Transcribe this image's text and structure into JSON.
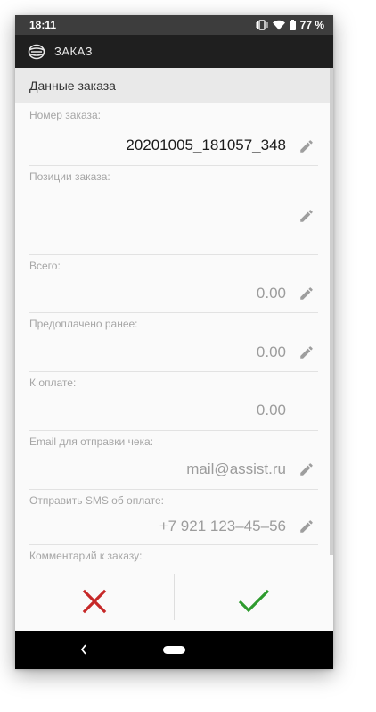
{
  "status_bar": {
    "time": "18:11",
    "battery": "77 %",
    "icons": [
      "vibrate-icon",
      "wifi-icon",
      "battery-icon"
    ]
  },
  "app_bar": {
    "logo_icon": "assist-logo-icon",
    "title": "ЗАКАЗ"
  },
  "section": {
    "title": "Данные заказа"
  },
  "fields": {
    "order_number": {
      "label": "Номер заказа:",
      "value": "20201005_181057_348"
    },
    "order_items": {
      "label": "Позиции заказа:",
      "value": ""
    },
    "total": {
      "label": "Всего:",
      "value": "0.00"
    },
    "prepaid": {
      "label": "Предоплачено ранее:",
      "value": "0.00"
    },
    "to_pay": {
      "label": "К оплате:",
      "value": "0.00"
    },
    "email": {
      "label": "Email для отправки чека:",
      "value": "mail@assist.ru"
    },
    "sms": {
      "label": "Отправить SMS об оплате:",
      "value": "+7 921 123–45–56"
    },
    "comment": {
      "label": "Комментарий к заказу:",
      "value": ""
    }
  },
  "actions": {
    "cancel_icon": "close-icon",
    "confirm_icon": "checkmark-icon"
  },
  "colors": {
    "cancel": "#c62828",
    "confirm": "#2e9b2e",
    "app_bar": "#1f1f1f",
    "status_bar": "#3d3d3d"
  }
}
